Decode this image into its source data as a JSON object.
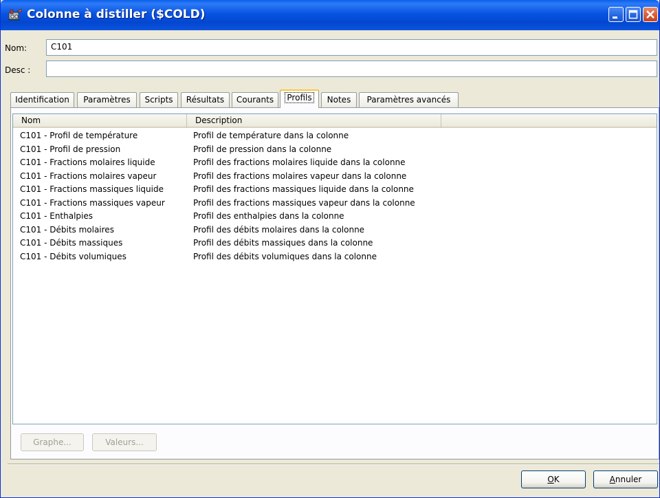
{
  "window": {
    "title": "Colonne à distiller ($COLD)",
    "icon": "distillation-column-icon",
    "controls": [
      "minimize-icon",
      "maximize-icon",
      "close-icon"
    ]
  },
  "header": {
    "nom_label": "Nom:",
    "nom_value": "C101",
    "desc_label": "Desc :",
    "desc_value": ""
  },
  "tabs": [
    {
      "label": "Identification",
      "active": false
    },
    {
      "label": "Paramètres",
      "active": false
    },
    {
      "label": "Scripts",
      "active": false
    },
    {
      "label": "Résultats",
      "active": false
    },
    {
      "label": "Courants",
      "active": false
    },
    {
      "label": "Profils",
      "active": true
    },
    {
      "label": "Notes",
      "active": false
    },
    {
      "label": "Paramètres avancés",
      "active": false
    }
  ],
  "table": {
    "columns": [
      "Nom",
      "Description"
    ],
    "rows": [
      {
        "nom": "C101 - Profil de température",
        "description": "Profil de température dans la colonne"
      },
      {
        "nom": "C101 - Profil de pression",
        "description": "Profil de pression dans la colonne"
      },
      {
        "nom": "C101 - Fractions molaires liquide",
        "description": "Profil des fractions molaires liquide dans la colonne"
      },
      {
        "nom": "C101 - Fractions molaires vapeur",
        "description": "Profil des fractions molaires vapeur dans la colonne"
      },
      {
        "nom": "C101 - Fractions massiques liquide",
        "description": "Profil des fractions massiques liquide dans la colonne"
      },
      {
        "nom": "C101 - Fractions massiques vapeur",
        "description": "Profil des fractions massiques vapeur dans la colonne"
      },
      {
        "nom": "C101 - Enthalpies",
        "description": "Profil des enthalpies dans la colonne"
      },
      {
        "nom": "C101 - Débits molaires",
        "description": "Profil des débits molaires dans la colonne"
      },
      {
        "nom": "C101 - Débits massiques",
        "description": "Profil des débits massiques dans la colonne"
      },
      {
        "nom": "C101 - Débits volumiques",
        "description": "Profil des débits volumiques dans la colonne"
      }
    ]
  },
  "panel_buttons": {
    "graphe": "Graphe...",
    "valeurs": "Valeurs..."
  },
  "footer": {
    "ok_prefix": "",
    "ok_underlined": "O",
    "ok_suffix": "K",
    "annuler_underlined": "A",
    "annuler_suffix": "nnuler"
  },
  "colors": {
    "titlebar": "#0854E3",
    "window_bg": "#ECE9D8",
    "active_tab_accent": "#FFC83C"
  }
}
